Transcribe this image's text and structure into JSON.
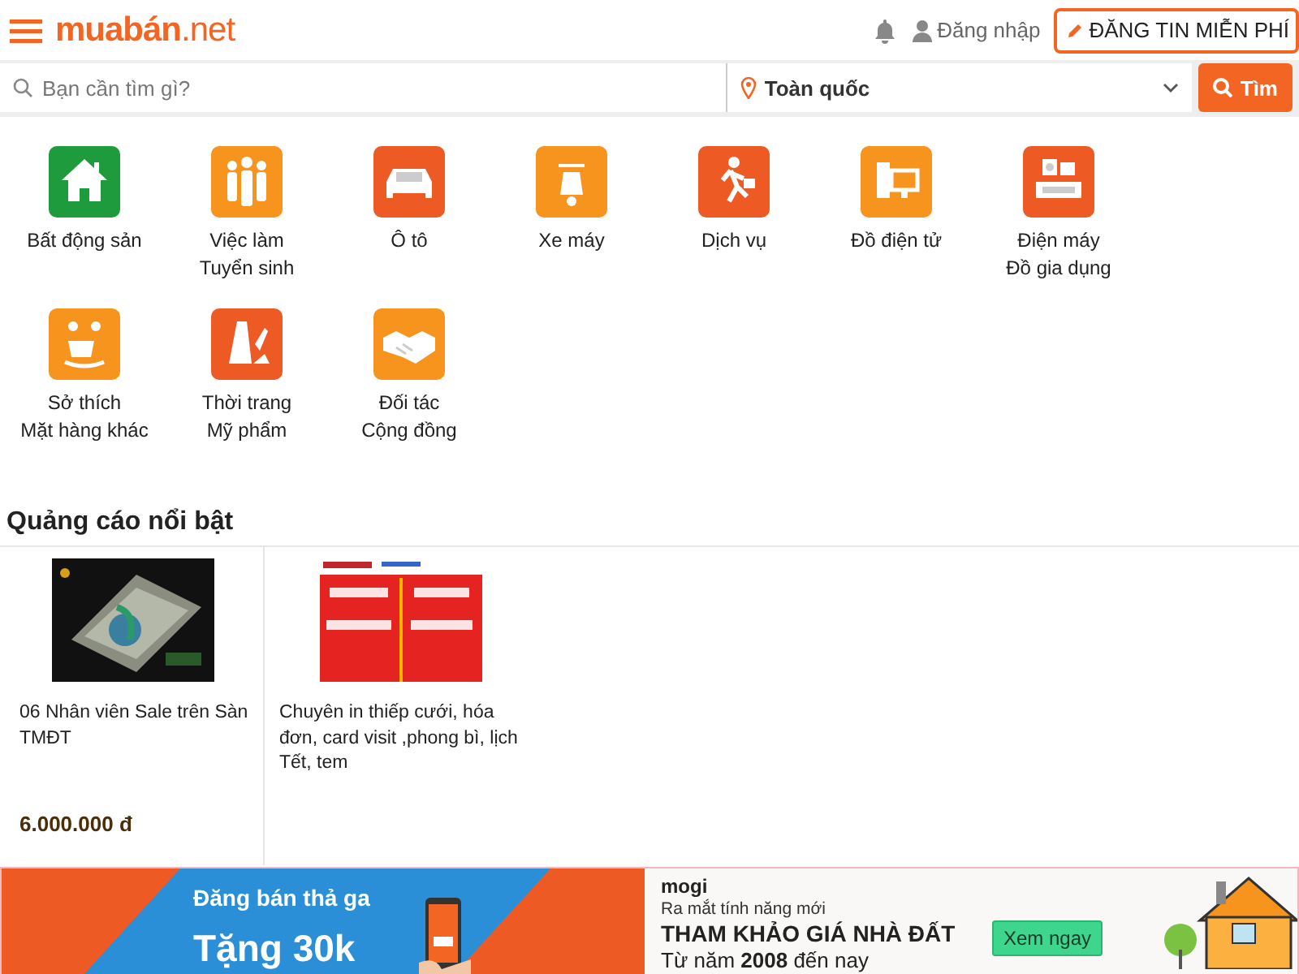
{
  "header": {
    "logo": "**muabán**.net",
    "login": "Đăng nhập",
    "post_button": "ĐĂNG TIN MIỄN PHÍ"
  },
  "search": {
    "placeholder": "Bạn cần tìm gì?",
    "location": "Toàn quốc",
    "button": "Tìm"
  },
  "categories": [
    {
      "label": "Bất động sản",
      "color": "#1e9b3c"
    },
    {
      "label": "Việc làm\nTuyển sinh",
      "color": "#f7941d"
    },
    {
      "label": "Ô tô",
      "color": "#ee5a24"
    },
    {
      "label": "Xe máy",
      "color": "#f7941d"
    },
    {
      "label": "Dịch vụ",
      "color": "#ee5a24"
    },
    {
      "label": "Đồ điện tử",
      "color": "#f7941d"
    },
    {
      "label": "Điện máy\nĐồ gia dụng",
      "color": "#ee5a24"
    },
    {
      "label": "Sở thích\nMặt hàng khác",
      "color": "#f7941d"
    },
    {
      "label": "Thời trang\nMỹ phẩm",
      "color": "#ee5a24"
    },
    {
      "label": "Đối tác\nCộng đồng",
      "color": "#f7941d"
    }
  ],
  "featured": {
    "title": "Quảng cáo nổi bật",
    "ads": [
      {
        "kind": "picture",
        "title": "06 Nhân viên Sale trên Sàn TMĐT",
        "price": "6.000.000 đ"
      },
      {
        "kind": "picture",
        "title": "Chuyên in thiếp cưới, hóa đơn, card visit ,phong bì, lịch Tết, tem"
      }
    ]
  },
  "banners": {
    "left": {
      "line1": "Đăng bán thả ga",
      "line2": "Tặng 30k"
    },
    "right": {
      "brand": "mogi",
      "subtitle": "Ra mắt tính năng mới",
      "headline": "THAM KHẢO GIÁ NHÀ ĐẤT",
      "button": "Xem ngay",
      "since": "Từ năm **2008** đến nay"
    }
  }
}
